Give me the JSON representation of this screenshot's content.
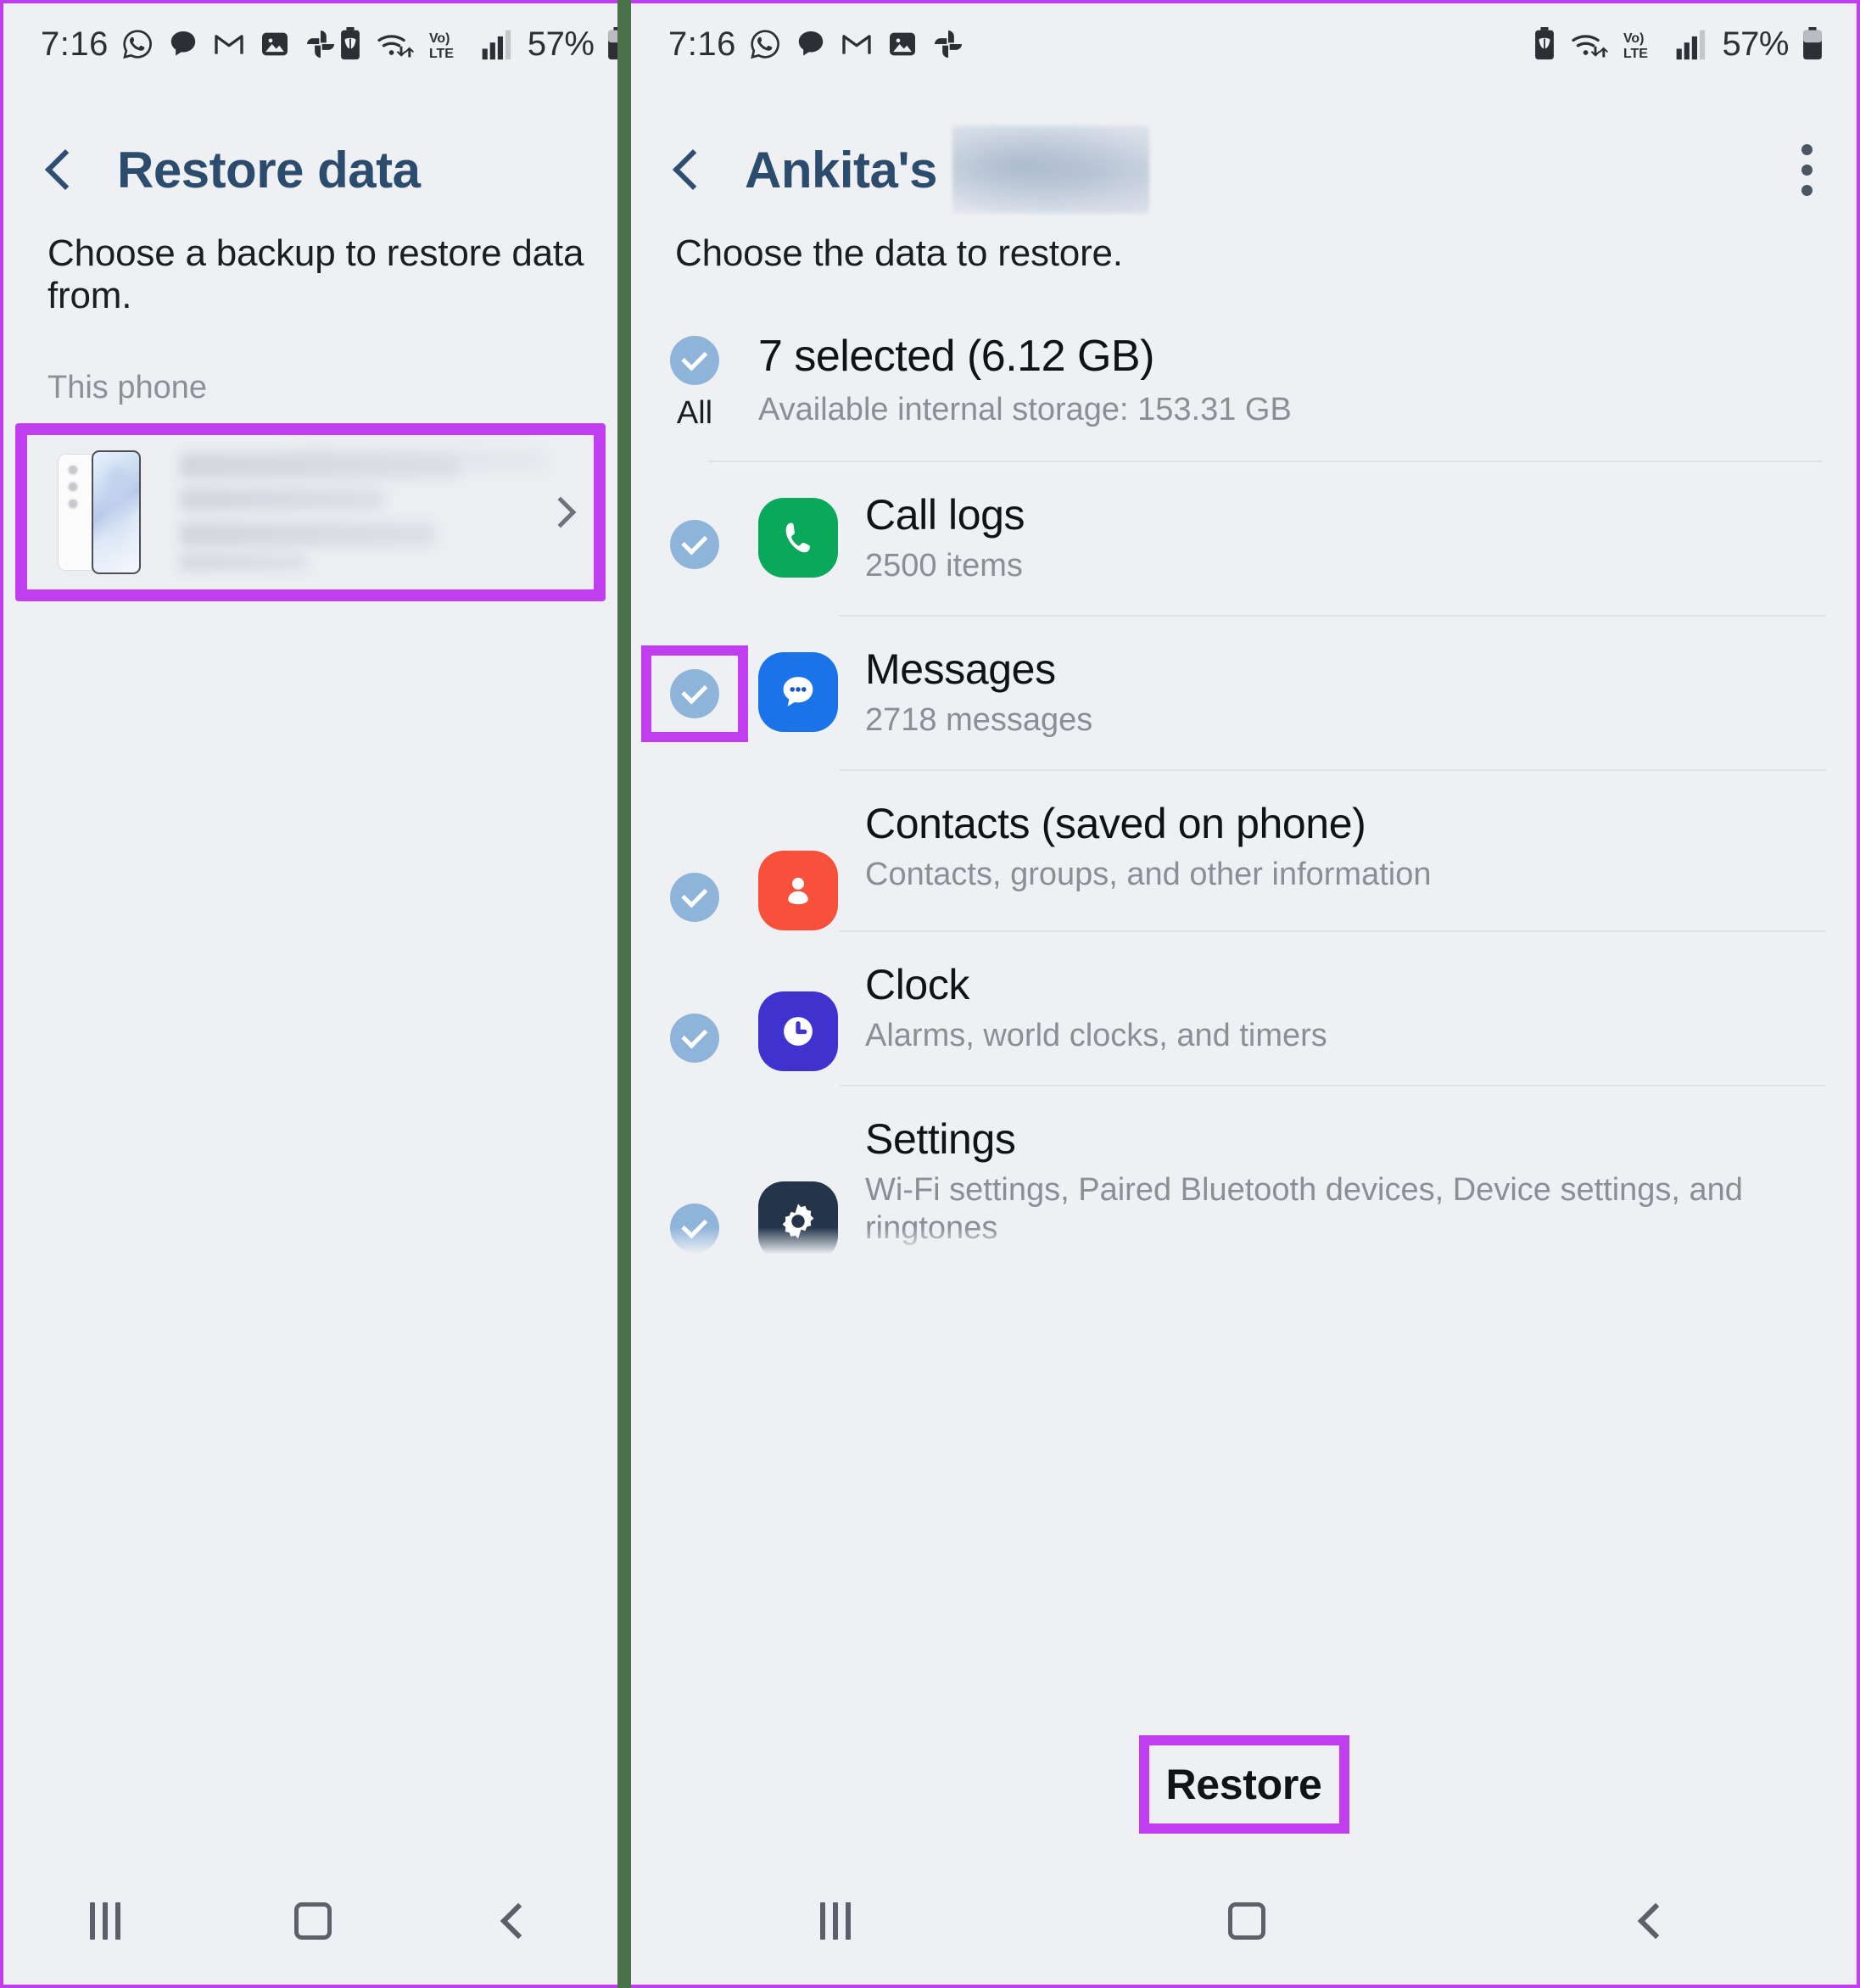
{
  "status_bar": {
    "time": "7:16",
    "battery_percent": "57%",
    "left_icons": [
      "whatsapp-icon",
      "chat-bubble-icon",
      "gmail-icon",
      "gallery-icon",
      "google-photos-icon"
    ],
    "right_icons": [
      "battery-saver-icon",
      "wifi-transfer-icon",
      "volte-icon",
      "signal-bars-icon",
      "battery-icon"
    ],
    "volte_label": "Vo)) LTE"
  },
  "left_screen": {
    "title": "Restore data",
    "back_icon": "back-chevron-icon",
    "subtitle": "Choose a backup to restore data from.",
    "section_label": "This phone",
    "device_card": {
      "thumbnail": "galaxy-phone-thumbnail",
      "name_redacted": "",
      "chevron": "chevron-right-icon",
      "highlighted": true
    },
    "nav": {
      "recents": "recents-button",
      "home": "home-button",
      "back": "back-button"
    }
  },
  "right_screen": {
    "title": "Ankita's",
    "title_redacted": "",
    "back_icon": "back-chevron-icon",
    "menu_icon": "more-options-icon",
    "subtitle": "Choose the data to restore.",
    "all_row": {
      "checkbox_label": "All",
      "checked": true,
      "title": "7 selected (6.12 GB)",
      "subtitle": "Available internal storage: 153.31 GB"
    },
    "items": [
      {
        "icon": "call-logs-icon",
        "icon_class": "ic-calllogs",
        "title": "Call logs",
        "subtitle": "2500 items",
        "checked": true,
        "highlighted": false
      },
      {
        "icon": "messages-icon",
        "icon_class": "ic-messages",
        "title": "Messages",
        "subtitle": "2718 messages",
        "checked": true,
        "highlighted": true
      },
      {
        "icon": "contacts-icon",
        "icon_class": "ic-contacts",
        "title": "Contacts (saved on phone)",
        "subtitle": "Contacts, groups, and other information",
        "checked": true,
        "highlighted": false
      },
      {
        "icon": "clock-icon",
        "icon_class": "ic-clock",
        "title": "Clock",
        "subtitle": "Alarms, world clocks, and timers",
        "checked": true,
        "highlighted": false
      },
      {
        "icon": "settings-icon",
        "icon_class": "ic-settings",
        "title": "Settings",
        "subtitle": "Wi-Fi settings, Paired Bluetooth devices, Device settings, and ringtones",
        "checked": true,
        "highlighted": false
      }
    ],
    "restore_button": {
      "label": "Restore",
      "highlighted": true
    },
    "nav": {
      "recents": "recents-button",
      "home": "home-button",
      "back": "back-button"
    }
  },
  "annotation": {
    "highlight_color": "#c13ef0",
    "separator_color": "#4a7249"
  }
}
